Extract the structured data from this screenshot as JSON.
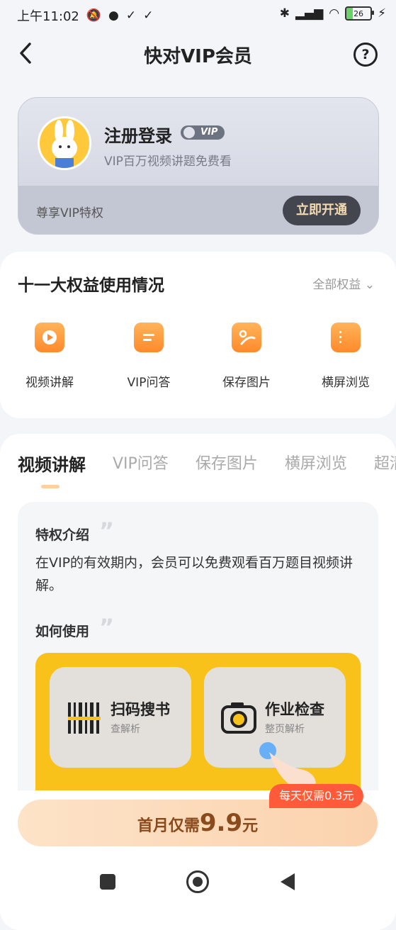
{
  "status_bar": {
    "time": "上午11:02",
    "battery": "26"
  },
  "header": {
    "title": "快对VIP会员",
    "help_glyph": "?"
  },
  "vip_card": {
    "name": "注册登录",
    "badge": "VIP",
    "subtitle": "VIP百万视频讲题免费看",
    "privilege": "尊享VIP特权",
    "open_button": "立即开通"
  },
  "rights": {
    "heading": "十一大权益使用情况",
    "all_link": "全部权益",
    "items": [
      {
        "label": "视频讲解",
        "icon": "video-icon"
      },
      {
        "label": "VIP问答",
        "icon": "chat-icon"
      },
      {
        "label": "保存图片",
        "icon": "image-icon"
      },
      {
        "label": "横屏浏览",
        "icon": "landscape-icon"
      }
    ]
  },
  "tabs": [
    "视频讲解",
    "VIP问答",
    "保存图片",
    "横屏浏览",
    "超清"
  ],
  "panel": {
    "intro_title": "特权介绍",
    "intro_text": "在VIP的有效期内，会员可以免费观看百万题目视频讲解。",
    "how_title": "如何使用",
    "cards": [
      {
        "title": "扫码搜书",
        "sub": "查解析"
      },
      {
        "title": "作业检查",
        "sub": "整页解析"
      }
    ]
  },
  "promo": {
    "tag": "每天仅需0.3元",
    "button_prefix": "首月仅需",
    "price": "9.9",
    "unit": "元"
  },
  "colors": {
    "accent": "#ff8a2b",
    "promo_red": "#ff5b3a",
    "buy_gradient_start": "#fde3c8"
  }
}
